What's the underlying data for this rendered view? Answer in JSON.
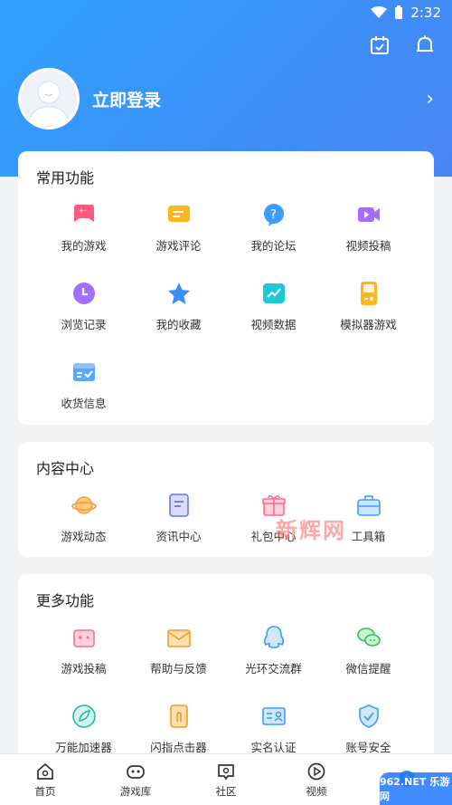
{
  "status_bar": {
    "time": "2:32"
  },
  "profile": {
    "login_text": "立即登录"
  },
  "common": {
    "title": "常用功能",
    "items": [
      {
        "label": "我的游戏",
        "icon": "game-controller-icon"
      },
      {
        "label": "游戏评论",
        "icon": "comment-icon"
      },
      {
        "label": "我的论坛",
        "icon": "question-bubble-icon"
      },
      {
        "label": "视频投稿",
        "icon": "video-camera-icon"
      },
      {
        "label": "浏览记录",
        "icon": "clock-icon"
      },
      {
        "label": "我的收藏",
        "icon": "star-icon"
      },
      {
        "label": "视频数据",
        "icon": "chart-icon"
      },
      {
        "label": "模拟器游戏",
        "icon": "gameboy-icon"
      },
      {
        "label": "收货信息",
        "icon": "address-card-icon"
      }
    ]
  },
  "content": {
    "title": "内容中心",
    "items": [
      {
        "label": "游戏动态",
        "icon": "planet-icon"
      },
      {
        "label": "资讯中心",
        "icon": "document-icon"
      },
      {
        "label": "礼包中心",
        "icon": "gift-icon"
      },
      {
        "label": "工具箱",
        "icon": "toolbox-icon"
      }
    ]
  },
  "more": {
    "title": "更多功能",
    "items": [
      {
        "label": "游戏投稿",
        "icon": "upload-game-icon"
      },
      {
        "label": "帮助与反馈",
        "icon": "mail-icon"
      },
      {
        "label": "光环交流群",
        "icon": "qq-icon"
      },
      {
        "label": "微信提醒",
        "icon": "wechat-icon"
      },
      {
        "label": "万能加速器",
        "icon": "rocket-icon"
      },
      {
        "label": "闪指点击器",
        "icon": "tap-icon"
      },
      {
        "label": "实名认证",
        "icon": "id-card-icon"
      },
      {
        "label": "账号安全",
        "icon": "shield-icon"
      }
    ]
  },
  "nav": {
    "items": [
      {
        "label": "首页"
      },
      {
        "label": "游戏库"
      },
      {
        "label": "社区"
      },
      {
        "label": "视频"
      },
      {
        "label": ""
      }
    ]
  },
  "watermark": {
    "text": "新辉网",
    "brand": "962.NET 乐游网"
  },
  "colors": {
    "header": "#3d8ef8",
    "background": "#f2f3f5",
    "accent": "#ff5a8a"
  }
}
